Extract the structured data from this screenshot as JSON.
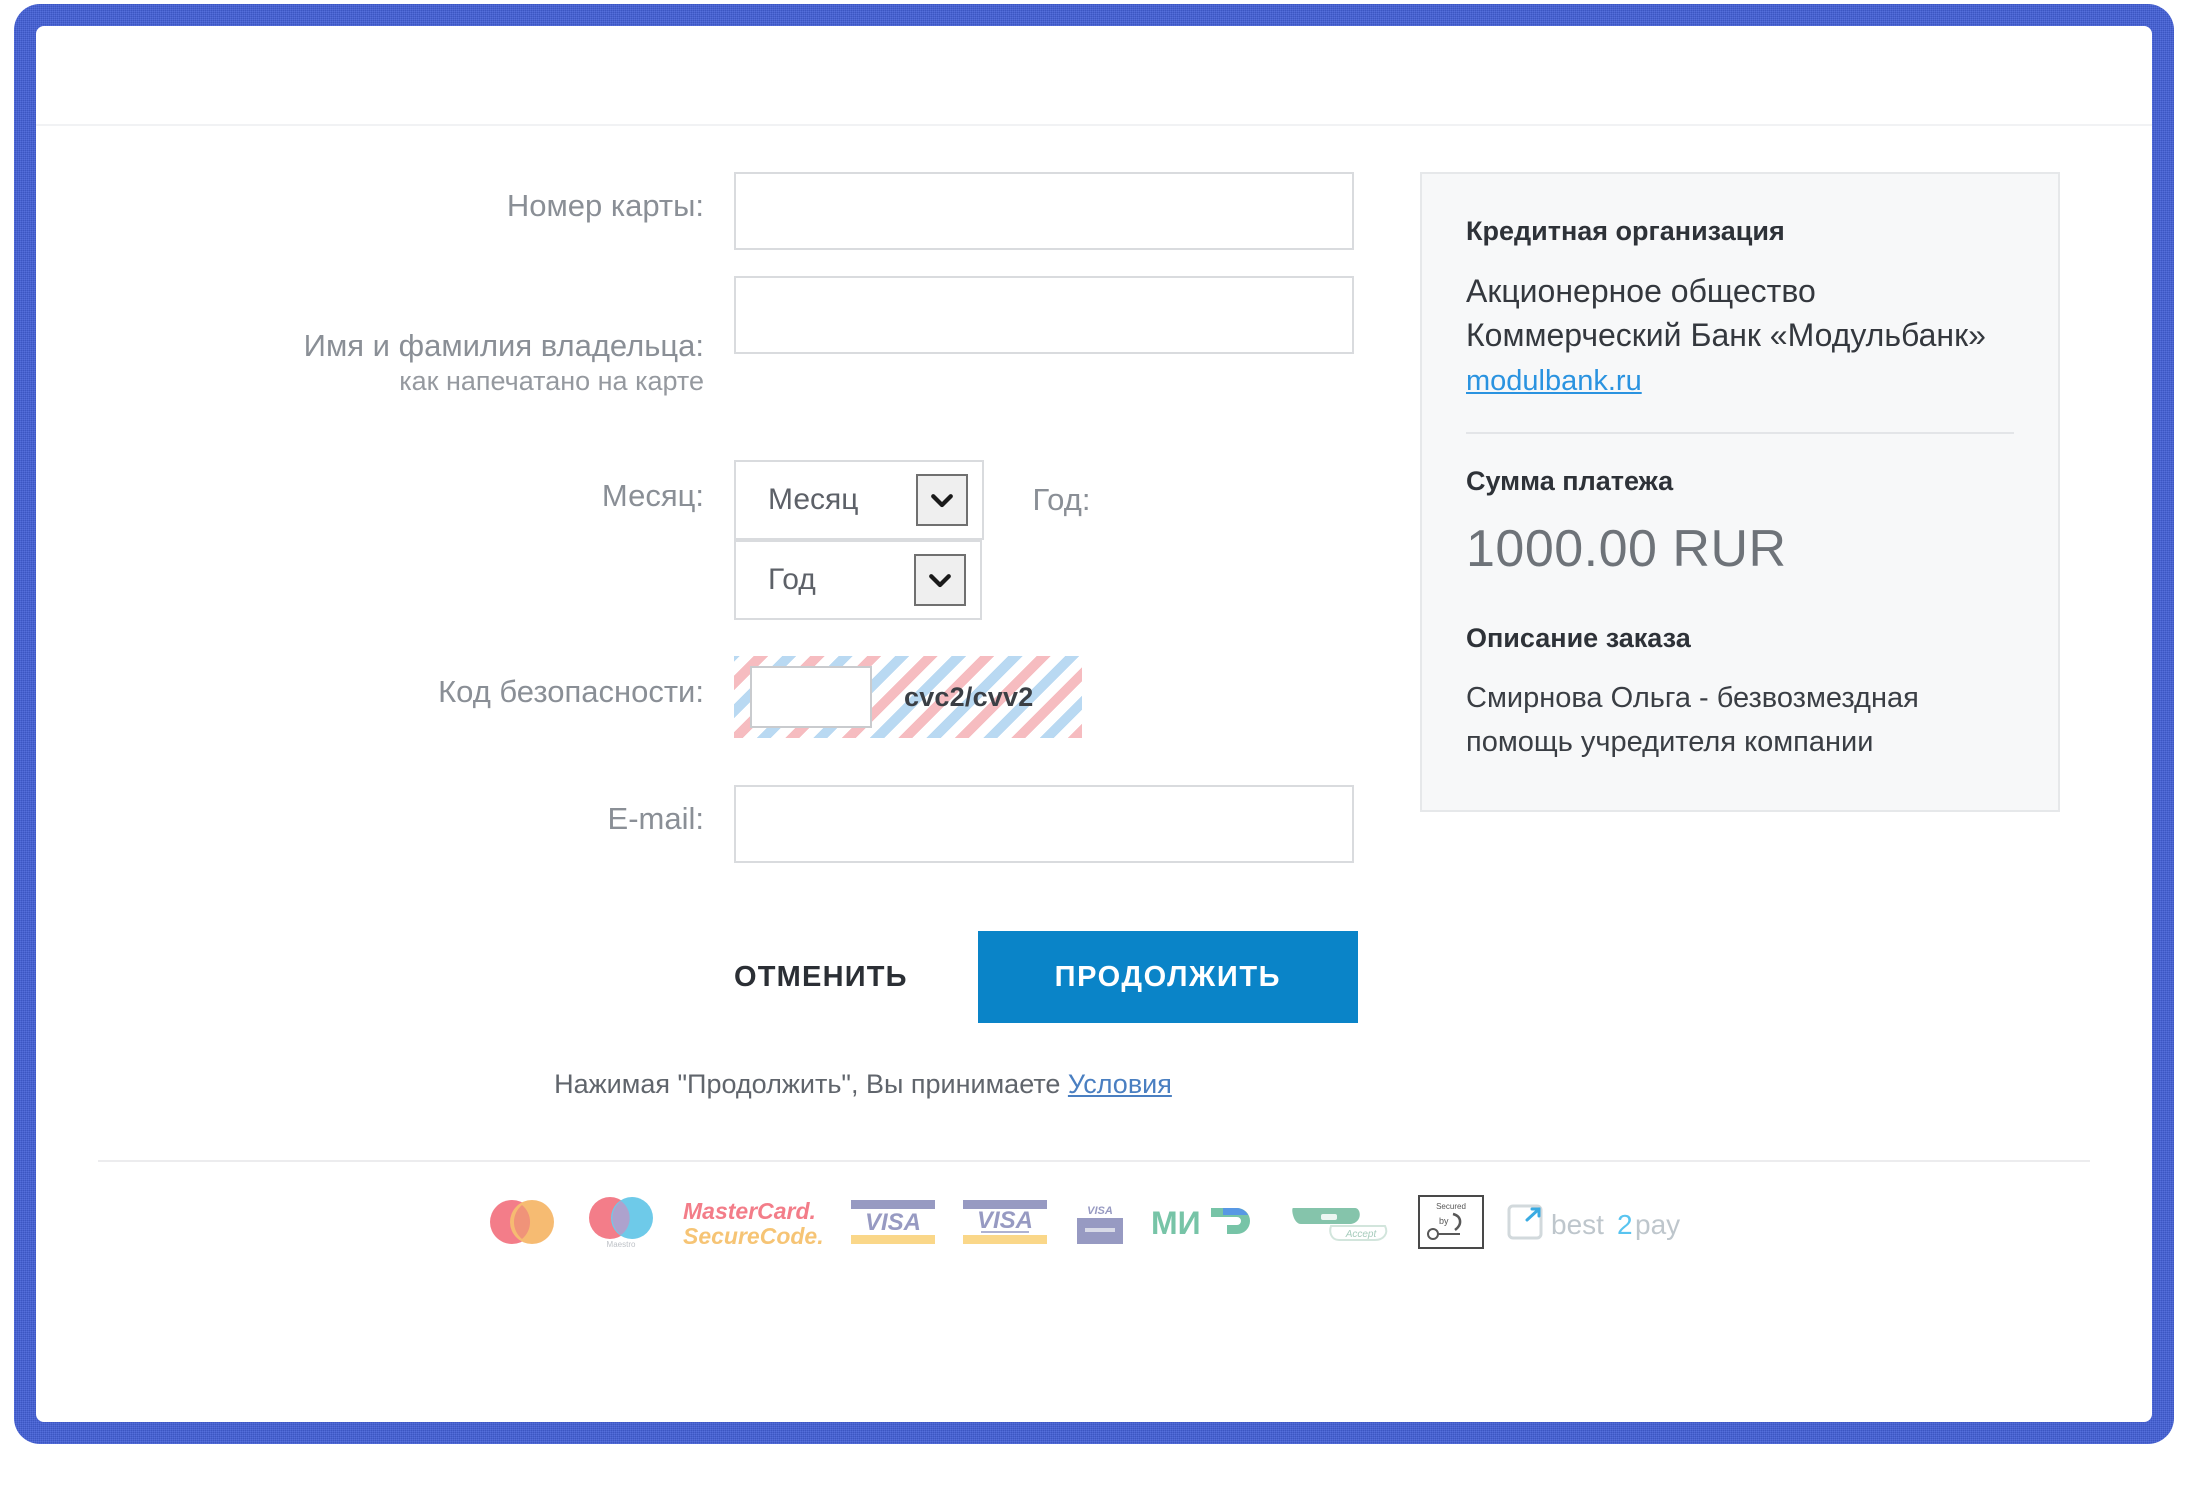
{
  "frame": {
    "accent_color": "#4360d8"
  },
  "form": {
    "card_number": {
      "label": "Номер карты:",
      "value": "",
      "placeholder": ""
    },
    "holder": {
      "label": "Имя и фамилия владельца:",
      "hint": "как напечатано на карте",
      "value": "",
      "placeholder": ""
    },
    "month": {
      "label": "Месяц:",
      "selected": "Месяц"
    },
    "year": {
      "label": "Год:",
      "selected": "Год"
    },
    "cvv": {
      "label": "Код безопасности:",
      "value": "",
      "tag": "cvc2/cvv2"
    },
    "email": {
      "label": "E-mail:",
      "value": "",
      "placeholder": ""
    }
  },
  "actions": {
    "cancel_label": "ОТМЕНИТЬ",
    "continue_label": "ПРОДОЛЖИТЬ",
    "continue_color": "#0a84c8",
    "terms_prefix": "Нажимая \"Продолжить\", Вы принимаете ",
    "terms_link": "Условия"
  },
  "side": {
    "org_heading": "Кредитная организация",
    "org_name": "Акционерное общество Коммерческий Банк «Модульбанк»",
    "org_link": "modulbank.ru",
    "amount_heading": "Сумма платежа",
    "amount": "1000.00 RUR",
    "descr_heading": "Описание заказа",
    "descr": "Смирнова Ольга - безвозмездная помощь учредителя компании"
  },
  "footer": {
    "logos": [
      {
        "name": "mastercard",
        "text": ""
      },
      {
        "name": "maestro",
        "text": "Maestro"
      },
      {
        "name": "mastercard-securecode",
        "line1": "MasterCard.",
        "line2": "SecureCode."
      },
      {
        "name": "visa",
        "text": "VISA"
      },
      {
        "name": "visa-verified",
        "text": "VISA"
      },
      {
        "name": "visa-secure",
        "text": "VISA"
      },
      {
        "name": "mir",
        "text": "МИР"
      },
      {
        "name": "mir-accept",
        "text": "Accept"
      },
      {
        "name": "secured-by",
        "text": "Secured by"
      },
      {
        "name": "best2pay",
        "text": "best2pay"
      }
    ]
  }
}
